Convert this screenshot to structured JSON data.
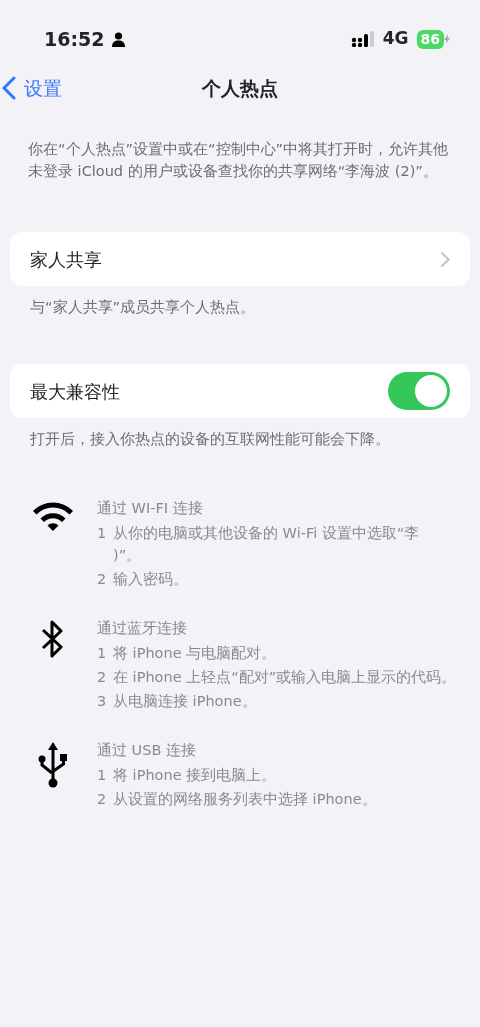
{
  "status_bar": {
    "time": "16:52",
    "network": "4G",
    "battery": "86",
    "charging": true
  },
  "nav": {
    "back": "设置",
    "title": "个人热点"
  },
  "intro": "你在“个人热点”设置中或在“控制中心”中将其打开时，允许其他未登录 iCloud 的用户或设备查找你的共享网络“李海波 (2)”。",
  "sections": [
    {
      "kind": "link",
      "label": "家人共享",
      "footer": "与“家人共享”成员共享个人热点。"
    },
    {
      "kind": "toggle",
      "label": "最大兼容性",
      "on": true,
      "footer": "打开后，接入你热点的设备的互联网性能可能会下降。"
    }
  ],
  "methods": [
    {
      "kind": "wifi",
      "title": "通过 WI-FI 连接",
      "steps": [
        {
          "number": "1",
          "text": "从你的电脑或其他设备的 Wi-Fi 设置中选取“李",
          "continuation": ")”。"
        },
        {
          "number": "2",
          "text": "输入密码。"
        }
      ]
    },
    {
      "kind": "bluetooth",
      "title": "通过蓝牙连接",
      "steps": [
        {
          "number": "1",
          "text": "将 iPhone 与电脑配对。"
        },
        {
          "number": "2",
          "text": "在 iPhone 上轻点“配对”或输入电脑上显示的代码。"
        },
        {
          "number": "3",
          "text": "从电脑连接 iPhone。"
        }
      ]
    },
    {
      "kind": "usb",
      "title": "通过 USB 连接",
      "steps": [
        {
          "number": "1",
          "text": "将 iPhone 接到电脑上。"
        },
        {
          "number": "2",
          "text": "从设置的网络服务列表中选择 iPhone。"
        }
      ]
    }
  ]
}
